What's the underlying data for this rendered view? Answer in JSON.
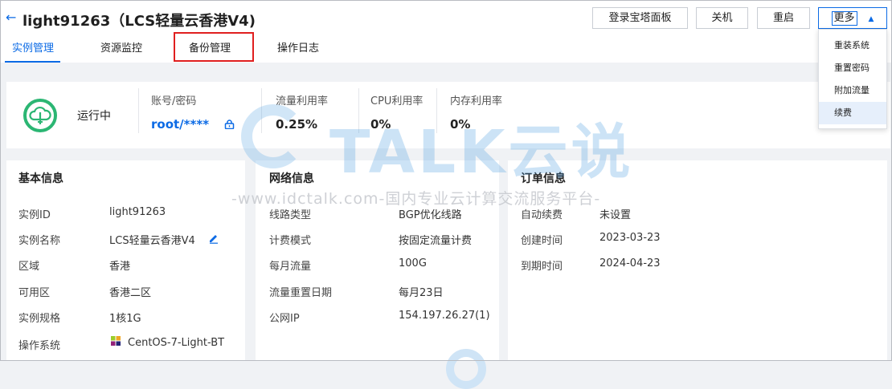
{
  "header": {
    "back_glyph": "←",
    "title": "light91263（LCS轻量云香港V4)",
    "buttons": {
      "login_panel": "登录宝塔面板",
      "shutdown": "关机",
      "restart": "重启",
      "more": "更多"
    }
  },
  "tabs": [
    {
      "label": "实例管理",
      "active": true
    },
    {
      "label": "资源监控",
      "active": false
    },
    {
      "label": "备份管理",
      "active": false,
      "highlighted": true
    },
    {
      "label": "操作日志",
      "active": false
    }
  ],
  "more_menu": {
    "items": [
      "重装系统",
      "重置密码",
      "附加流量",
      "续费"
    ],
    "active_index": 3
  },
  "status": {
    "state": "运行中",
    "account": {
      "label": "账号/密码",
      "value": "root/****"
    },
    "traffic": {
      "label": "流量利用率",
      "value": "0.25%"
    },
    "cpu": {
      "label": "CPU利用率",
      "value": "0%"
    },
    "memory": {
      "label": "内存利用率",
      "value": "0%"
    }
  },
  "basic": {
    "title": "基本信息",
    "rows": [
      {
        "label": "实例ID",
        "value": "light91263"
      },
      {
        "label": "实例名称",
        "value": "LCS轻量云香港V4"
      },
      {
        "label": "区域",
        "value": "香港"
      },
      {
        "label": "可用区",
        "value": "香港二区"
      },
      {
        "label": "实例规格",
        "value": "1核1G"
      },
      {
        "label": "操作系统",
        "value": "CentOS-7-Light-BT"
      }
    ]
  },
  "network": {
    "title": "网络信息",
    "rows": [
      {
        "label": "线路类型",
        "value": "BGP优化线路"
      },
      {
        "label": "计费模式",
        "value": "按固定流量计费"
      },
      {
        "label": "每月流量",
        "value": "100G"
      },
      {
        "label": "流量重置日期",
        "value": "每月23日"
      },
      {
        "label": "公网IP",
        "value": "154.197.26.27(1)"
      }
    ]
  },
  "order": {
    "title": "订单信息",
    "rows": [
      {
        "label": "自动续费",
        "value": "未设置"
      },
      {
        "label": "创建时间",
        "value": "2023-03-23"
      },
      {
        "label": "到期时间",
        "value": "2024-04-23"
      }
    ]
  },
  "watermark": {
    "brand": "TALK云说",
    "url_text": "-www.idctalk.com-国内专业云计算交流服务平台-"
  },
  "colors": {
    "accent": "#0b6ae5",
    "highlight_border": "#e01f1f",
    "status_green": "#2bb673"
  }
}
